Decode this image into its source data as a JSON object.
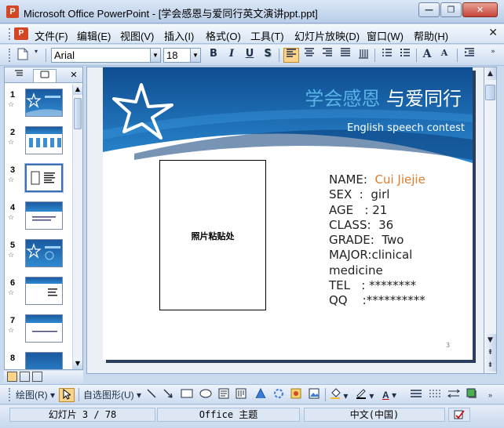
{
  "window": {
    "title": "Microsoft Office PowerPoint - [学会感恩与爱同行英文演讲ppt.ppt]",
    "app_icon": "P",
    "minimize": "—",
    "restore": "❐",
    "close": "✕"
  },
  "menu": {
    "items": [
      "文件(F)",
      "编辑(E)",
      "视图(V)",
      "插入(I)",
      "格式(O)",
      "工具(T)",
      "幻灯片放映(D)",
      "窗口(W)",
      "帮助(H)"
    ],
    "close": "✕"
  },
  "toolbar": {
    "font_name": "Arial",
    "font_size": "18",
    "bold": "B",
    "italic": "I",
    "underline": "U",
    "shadow": "S",
    "grow_font": "A",
    "shrink_font": "A"
  },
  "left_pane": {
    "slides": [
      {
        "num": "1"
      },
      {
        "num": "2"
      },
      {
        "num": "3"
      },
      {
        "num": "4"
      },
      {
        "num": "5"
      },
      {
        "num": "6"
      },
      {
        "num": "7"
      },
      {
        "num": "8"
      }
    ],
    "selected": "3",
    "tab_close": "✕"
  },
  "slide": {
    "title_part1": "学会感恩",
    "title_part2": "与爱同行",
    "subtitle": "English speech contest",
    "photo_label": "照片粘贴处",
    "info": {
      "name_label": "NAME:",
      "name_value": "Cui Jiejie",
      "sex": "SEX  :  girl",
      "age": "AGE   : 21",
      "class": "CLASS:  36",
      "grade": "GRADE:  Two",
      "major1": "MAJOR:clinical",
      "major2": "medicine",
      "tel": "TEL   : ********",
      "qq": "QQ    :**********"
    },
    "page_number": "3"
  },
  "drawbar": {
    "draw": "绘图(R)",
    "autoshapes": "自选图形(U)"
  },
  "status": {
    "slide_pos": "幻灯片 3 / 78",
    "theme": "Office 主题",
    "language": "中文(中国)"
  },
  "colors": {
    "slide_blue": "#1a5aa0",
    "name_accent": "#e07b2a",
    "title_light_blue": "#5ab2e6"
  }
}
